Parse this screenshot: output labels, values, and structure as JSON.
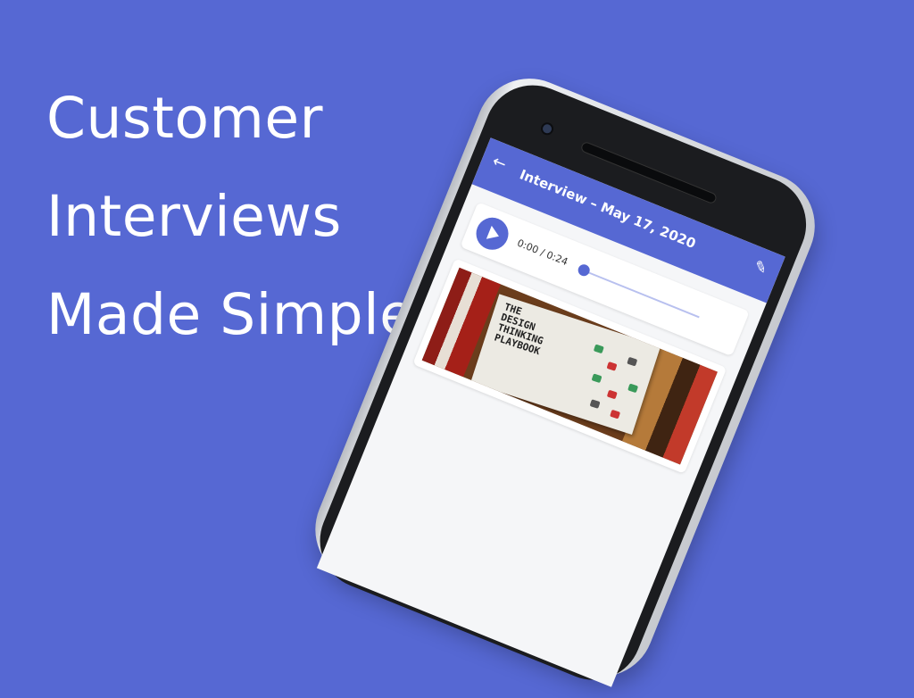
{
  "headline": {
    "line1": "Customer",
    "line2": "Interviews",
    "line3": "Made Simple"
  },
  "app": {
    "title": "Interview – May 17, 2020",
    "back_icon": "arrow-left-icon",
    "edit_icon": "pencil-icon",
    "audio": {
      "time": "0:00 / 0:24",
      "progress": 0
    },
    "photo": {
      "book_title": "THE\nDESIGN\nTHINKING\nPLAYBOOK"
    }
  },
  "colors": {
    "background": "#5668d3",
    "accent": "#5668d3"
  }
}
